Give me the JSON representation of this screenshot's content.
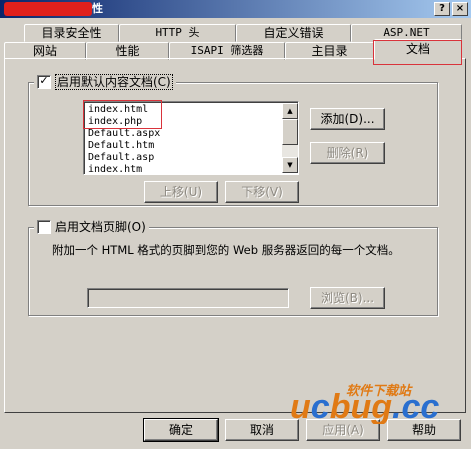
{
  "window": {
    "title": "性",
    "help_label": "?",
    "close_label": "×"
  },
  "tabs": {
    "row1": [
      "目录安全性",
      "HTTP 头",
      "自定义错误",
      "ASP.NET"
    ],
    "row2": [
      "网站",
      "性能",
      "ISAPI 筛选器",
      "主目录",
      "文档"
    ],
    "active": "文档"
  },
  "default_content": {
    "checkbox_label": "启用默认内容文档(C)",
    "checked": true,
    "documents": [
      "index.html",
      "index.php",
      "Default.aspx",
      "Default.htm",
      "Default.asp",
      "index.htm"
    ],
    "add_label": "添加(D)...",
    "remove_label": "删除(R)",
    "move_up_label": "上移(U)",
    "move_down_label": "下移(V)"
  },
  "footer": {
    "checkbox_label": "启用文档页脚(O)",
    "checked": false,
    "description": "附加一个 HTML 格式的页脚到您的 Web 服务器返回的每一个文档。",
    "path_value": "",
    "browse_label": "浏览(B)..."
  },
  "buttons": {
    "ok": "确定",
    "cancel": "取消",
    "apply": "应用(A)",
    "help": "帮助"
  },
  "watermark": {
    "logo": "ucbug.cc",
    "text": "软件下载站"
  },
  "colors": {
    "face": "#d4d0c8",
    "annotation_red": "#d9333b",
    "watermark_orange": "#e07a15",
    "watermark_blue": "#2a6fcf"
  }
}
